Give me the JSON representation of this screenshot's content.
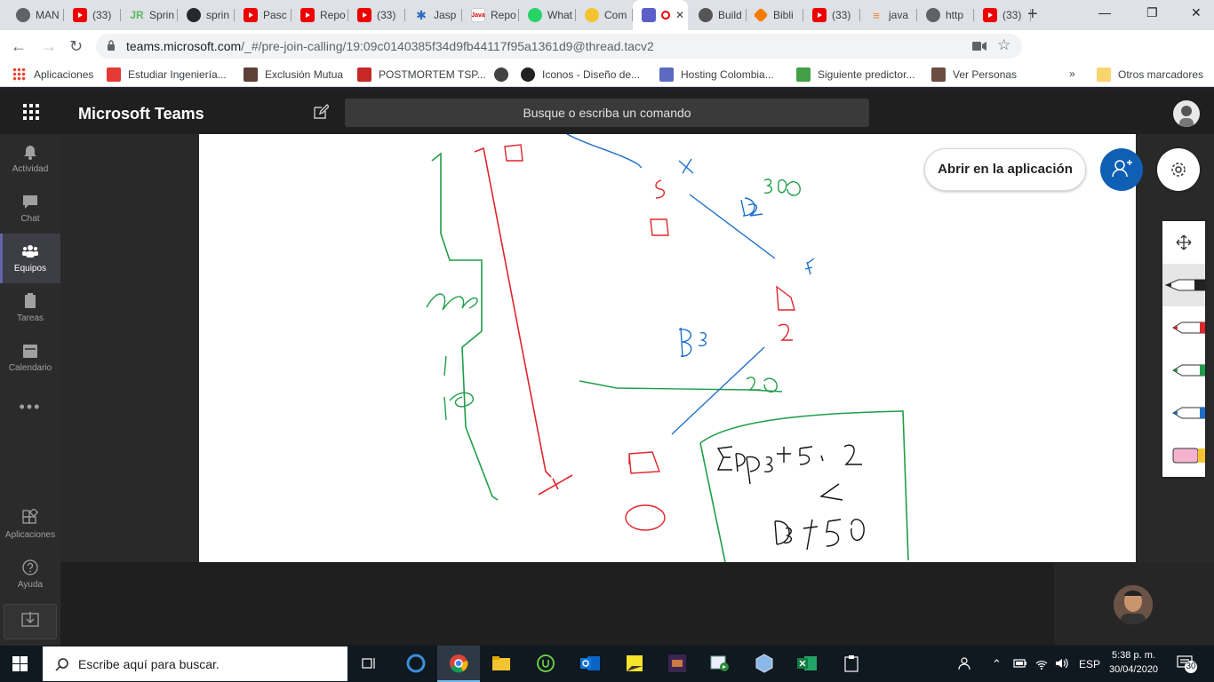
{
  "browser": {
    "tabs": [
      {
        "label": "MAN",
        "icon": "globe-icon"
      },
      {
        "label": "(33)",
        "icon": "youtube-icon"
      },
      {
        "label": "Sprin",
        "icon": "jr-icon"
      },
      {
        "label": "sprin",
        "icon": "github-icon"
      },
      {
        "label": "Pasc",
        "icon": "youtube-icon"
      },
      {
        "label": "Repo",
        "icon": "youtube-icon"
      },
      {
        "label": "(33)",
        "icon": "youtube-icon"
      },
      {
        "label": "Jasp",
        "icon": "jasper-icon"
      },
      {
        "label": "Repo",
        "icon": "java-icon"
      },
      {
        "label": "What",
        "icon": "whatsapp-icon"
      },
      {
        "label": "Com",
        "icon": "comedy-icon"
      },
      {
        "label": "",
        "icon": "teams-icon",
        "active": true
      },
      {
        "label": "Build",
        "icon": "build-icon"
      },
      {
        "label": "Bibli",
        "icon": "bibliotheca-icon"
      },
      {
        "label": "(33)",
        "icon": "youtube-icon"
      },
      {
        "label": "java",
        "icon": "stackoverflow-icon"
      },
      {
        "label": "http",
        "icon": "globe-icon"
      },
      {
        "label": "(33)",
        "icon": "youtube-icon"
      }
    ],
    "address": {
      "host": "teams.microsoft.com",
      "path": "/_#/pre-join-calling/19:09c0140385f34d9fb44117f95a1361d9@thread.tacv2"
    },
    "bookmarks": [
      {
        "label": "Aplicaciones",
        "color": "#4285f4"
      },
      {
        "label": "Estudiar Ingeniería...",
        "color": "#e53935"
      },
      {
        "label": "Exclusión Mutua",
        "color": "#5d4037"
      },
      {
        "label": "POSTMORTEM TSP...",
        "color": "#c62828"
      },
      {
        "label": "",
        "color": "#424242"
      },
      {
        "label": "Iconos - Diseño de...",
        "color": "#212121"
      },
      {
        "label": "Hosting Colombia...",
        "color": "#5c6bc0"
      },
      {
        "label": "Siguiente predictor...",
        "color": "#43a047"
      },
      {
        "label": "Ver Personas",
        "color": "#6d4c41"
      }
    ],
    "bookmarks_more": "»",
    "other_bookmarks": "Otros marcadores"
  },
  "teams": {
    "title": "Microsoft Teams",
    "search_placeholder": "Busque o escriba un comando",
    "rail": [
      {
        "label": "Actividad",
        "icon": "bell-icon"
      },
      {
        "label": "Chat",
        "icon": "chat-icon"
      },
      {
        "label": "Equipos",
        "icon": "teams-icon",
        "active": true
      },
      {
        "label": "Tareas",
        "icon": "tasks-icon"
      },
      {
        "label": "Calendario",
        "icon": "calendar-icon"
      }
    ],
    "rail_more": "•••",
    "rail_bottom": [
      {
        "label": "Aplicaciones",
        "icon": "apps-icon"
      },
      {
        "label": "Ayuda",
        "icon": "help-icon"
      }
    ],
    "open_app_label": "Abrir en la aplicación"
  },
  "whiteboard": {
    "colors": {
      "red": "#e0252c",
      "green": "#1f9e48",
      "blue": "#1e6fc9",
      "black": "#111111"
    },
    "pens": [
      "black",
      "red",
      "green",
      "blue",
      "highlighter"
    ]
  },
  "taskbar": {
    "search_text": "Escribe aquí para buscar.",
    "language": "ESP",
    "time": "5:38 p. m.",
    "date": "30/04/2020",
    "notifications": "30"
  }
}
